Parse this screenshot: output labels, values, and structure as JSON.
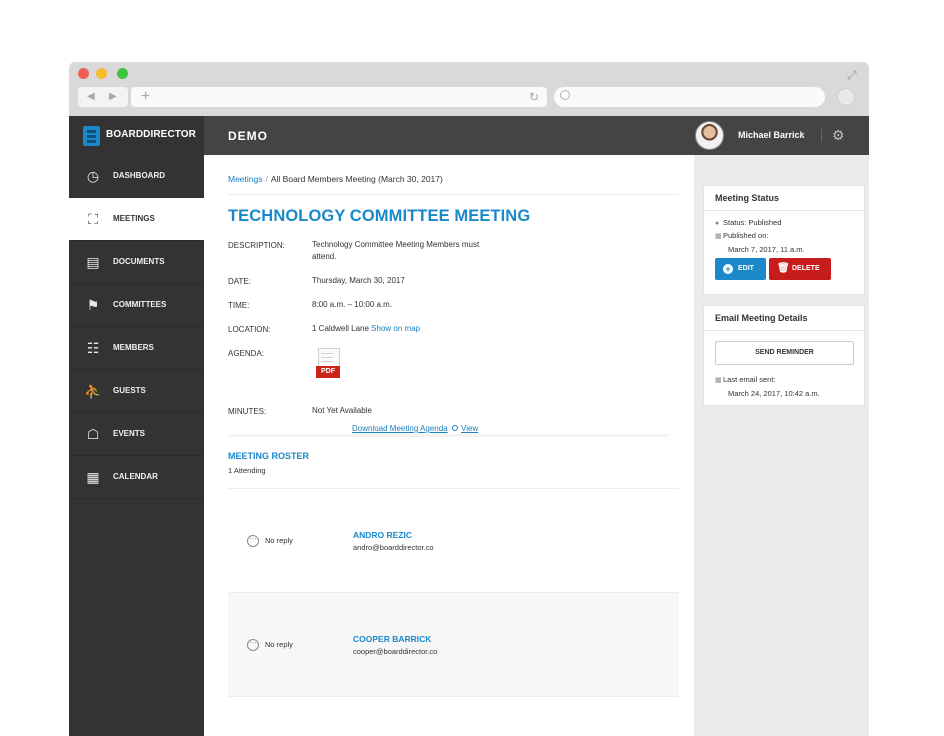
{
  "browser": {
    "icons": {
      "back": "chevron-left-icon",
      "forward": "chevron-right-icon",
      "new_tab": "plus-icon",
      "reload": "reload-icon",
      "search": "search-icon",
      "expand": "expand-icon"
    }
  },
  "header": {
    "brand": "BOARDDIRECTOR",
    "org_name": "DEMO",
    "user_name": "Michael Barrick",
    "caret": "▾",
    "gear": "⚙"
  },
  "sidebar": {
    "items": [
      {
        "label": "DASHBOARD",
        "icon": "◷",
        "active": false
      },
      {
        "label": "MEETINGS",
        "icon": "⛶",
        "active": true
      },
      {
        "label": "DOCUMENTS",
        "icon": "▤",
        "active": false
      },
      {
        "label": "COMMITTEES",
        "icon": "⚑",
        "active": false
      },
      {
        "label": "MEMBERS",
        "icon": "☷",
        "active": false
      },
      {
        "label": "GUESTS",
        "icon": "⛹",
        "active": false
      },
      {
        "label": "EVENTS",
        "icon": "☖",
        "active": false
      },
      {
        "label": "CALENDAR",
        "icon": "▦",
        "active": false
      }
    ]
  },
  "breadcrumb": {
    "root": "Meetings",
    "separator": "/",
    "current": "All Board Members Meeting (March 30, 2017)"
  },
  "meeting": {
    "title": "TECHNOLOGY COMMITTEE MEETING",
    "description_label": "DESCRIPTION:",
    "description": "Technology Committee Meeting Members must attend.",
    "date_label": "DATE:",
    "date": "Thursday, March 30, 2017",
    "time_label": "TIME:",
    "time": "8:00 a.m. – 10:00 a.m.",
    "location_label": "LOCATION:",
    "location": "1 Caldwell Lane",
    "location_map_link": "Show on map",
    "agenda_label": "AGENDA:",
    "agenda_file_type": "PDF",
    "agenda_download": "Download Meeting Agenda",
    "agenda_view": "View",
    "minutes_label": "MINUTES:",
    "minutes": "Not Yet Available"
  },
  "roster": {
    "title": "MEETING ROSTER",
    "count": "1 Attending",
    "members": [
      {
        "reply": "No reply",
        "reply_icon": "⋯",
        "name": "ANDRO REZIC",
        "email": "andro@boarddirector.co"
      },
      {
        "reply": "No reply",
        "reply_icon": "⋯",
        "name": "COOPER BARRICK",
        "email": "cooper@boarddirector.co"
      }
    ]
  },
  "status_panel": {
    "title": "Meeting Status",
    "status": "Status: Published",
    "published_on_label": "Published on:",
    "published_on": "March 7, 2017, 11 a.m.",
    "edit_label": "EDIT",
    "delete_label": "DELETE",
    "edit_icon": "+",
    "delete_icon": "🗑"
  },
  "email_panel": {
    "title": "Email Meeting Details",
    "send_label": "SEND REMINDER",
    "last_sent_label": "Last email sent:",
    "last_sent": "March 24, 2017, 10:42 a.m."
  },
  "colors": {
    "accent": "#1a88c9",
    "danger": "#c81c1c",
    "sidebar": "#333333",
    "topbar": "#444444"
  }
}
